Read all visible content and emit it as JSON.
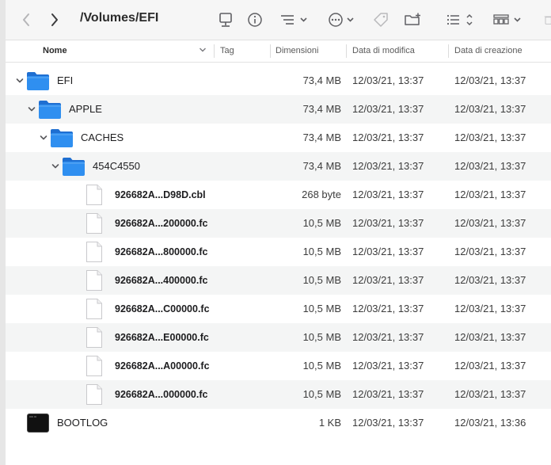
{
  "toolbar": {
    "path_title": "/Volumes/EFI"
  },
  "columns": {
    "name": "Nome",
    "tag": "Tag",
    "size": "Dimensioni",
    "modified": "Data di modifica",
    "created": "Data di creazione"
  },
  "rows": [
    {
      "name": "EFI",
      "size": "73,4 MB",
      "modified": "12/03/21, 13:37",
      "created": "12/03/21, 13:37",
      "kind": "folder",
      "depth": 0,
      "expanded": true
    },
    {
      "name": "APPLE",
      "size": "73,4 MB",
      "modified": "12/03/21, 13:37",
      "created": "12/03/21, 13:37",
      "kind": "folder",
      "depth": 1,
      "expanded": true
    },
    {
      "name": "CACHES",
      "size": "73,4 MB",
      "modified": "12/03/21, 13:37",
      "created": "12/03/21, 13:37",
      "kind": "folder",
      "depth": 2,
      "expanded": true
    },
    {
      "name": "454C4550",
      "size": "73,4 MB",
      "modified": "12/03/21, 13:37",
      "created": "12/03/21, 13:37",
      "kind": "folder",
      "depth": 3,
      "expanded": true
    },
    {
      "name": "926682A...D98D.cbl",
      "size": "268 byte",
      "modified": "12/03/21, 13:37",
      "created": "12/03/21, 13:37",
      "kind": "file",
      "depth": 4
    },
    {
      "name": "926682A...200000.fc",
      "size": "10,5 MB",
      "modified": "12/03/21, 13:37",
      "created": "12/03/21, 13:37",
      "kind": "file",
      "depth": 4
    },
    {
      "name": "926682A...800000.fc",
      "size": "10,5 MB",
      "modified": "12/03/21, 13:37",
      "created": "12/03/21, 13:37",
      "kind": "file",
      "depth": 4
    },
    {
      "name": "926682A...400000.fc",
      "size": "10,5 MB",
      "modified": "12/03/21, 13:37",
      "created": "12/03/21, 13:37",
      "kind": "file",
      "depth": 4
    },
    {
      "name": "926682A...C00000.fc",
      "size": "10,5 MB",
      "modified": "12/03/21, 13:37",
      "created": "12/03/21, 13:37",
      "kind": "file",
      "depth": 4
    },
    {
      "name": "926682A...E00000.fc",
      "size": "10,5 MB",
      "modified": "12/03/21, 13:37",
      "created": "12/03/21, 13:37",
      "kind": "file",
      "depth": 4
    },
    {
      "name": "926682A...A00000.fc",
      "size": "10,5 MB",
      "modified": "12/03/21, 13:37",
      "created": "12/03/21, 13:37",
      "kind": "file",
      "depth": 4
    },
    {
      "name": "926682A...000000.fc",
      "size": "10,5 MB",
      "modified": "12/03/21, 13:37",
      "created": "12/03/21, 13:37",
      "kind": "file",
      "depth": 4
    },
    {
      "name": "BOOTLOG",
      "size": "1 KB",
      "modified": "12/03/21, 13:37",
      "created": "12/03/21, 13:36",
      "kind": "exec",
      "depth": 0
    }
  ],
  "icons": {
    "back": "chevron-left-icon",
    "forward": "chevron-right-icon",
    "server": "computer-icon",
    "info": "info-icon",
    "group": "group-by-icon",
    "action": "more-actions-icon",
    "tag": "tag-icon",
    "new_folder": "new-folder-icon",
    "view": "list-view-icon",
    "gallery": "gallery-view-icon",
    "trash": "trash-icon"
  },
  "colors": {
    "folder": "#2f8ff0",
    "folder_dark": "#1f6fd1",
    "row_alt": "#f4f5f5"
  }
}
